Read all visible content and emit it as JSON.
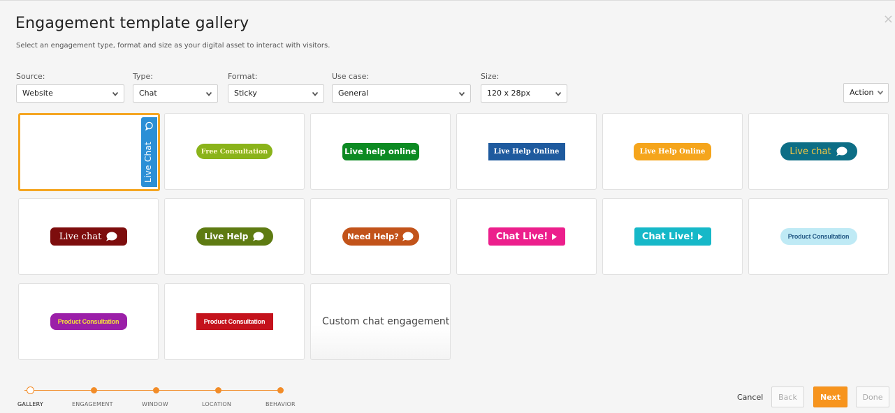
{
  "dialog": {
    "title": "Engagement template gallery",
    "subtitle": "Select an engagement type, format and size as your digital asset to interact with visitors.",
    "close_label": "×"
  },
  "filters": {
    "source": {
      "label": "Source:",
      "value": "Website"
    },
    "type": {
      "label": "Type:",
      "value": "Chat"
    },
    "format": {
      "label": "Format:",
      "value": "Sticky"
    },
    "use_case": {
      "label": "Use case:",
      "value": "General"
    },
    "size": {
      "label": "Size:",
      "value": "120 x 28px"
    },
    "action_label": "Action"
  },
  "templates": [
    {
      "text": "Live Chat",
      "bg": "#2b8fd6",
      "fg": "#ffffff",
      "selected": true
    },
    {
      "text": "Free Consultation",
      "bg": "#8ab31a",
      "fg": "#fff8c8"
    },
    {
      "text": "Live help online",
      "bg": "#0c8a22",
      "fg": "#ffffff"
    },
    {
      "text": "Live Help Online",
      "bg": "#1e5a9e",
      "fg": "#ffffff"
    },
    {
      "text": "Live Help Online",
      "bg": "#f5a51c",
      "fg": "#ffffff"
    },
    {
      "text": "Live chat",
      "bg": "#0d6e86",
      "fg": "#f5c842"
    },
    {
      "text": "Live chat",
      "bg": "#7d0d0d",
      "fg": "#ffffff"
    },
    {
      "text": "Live Help",
      "bg": "#5e7b12",
      "fg": "#ffffff"
    },
    {
      "text": "Need Help?",
      "bg": "#c2531a",
      "fg": "#ffffff"
    },
    {
      "text": "Chat Live!",
      "bg": "#ec1f8c",
      "fg": "#ffffff"
    },
    {
      "text": "Chat Live!",
      "bg": "#16b8c8",
      "fg": "#ffffff"
    },
    {
      "text": "Product Consultation",
      "bg": "#bfeaf5",
      "fg": "#245a86"
    },
    {
      "text": "Product Consultation",
      "bg": "#9b1fa8",
      "fg": "#f5e23a"
    },
    {
      "text": "Product Consultation",
      "bg": "#c4121c",
      "fg": "#ffffff"
    },
    {
      "text": "Custom chat engagement"
    }
  ],
  "steps": [
    {
      "label": "GALLERY",
      "state": "current"
    },
    {
      "label": "ENGAGEMENT",
      "state": "pending"
    },
    {
      "label": "WINDOW",
      "state": "pending"
    },
    {
      "label": "LOCATION",
      "state": "pending"
    },
    {
      "label": "BEHAVIOR",
      "state": "pending"
    }
  ],
  "footer": {
    "cancel": "Cancel",
    "back": "Back",
    "next": "Next",
    "done": "Done"
  },
  "colors": {
    "accent": "#f7941d",
    "selected_border": "#f5a623"
  }
}
